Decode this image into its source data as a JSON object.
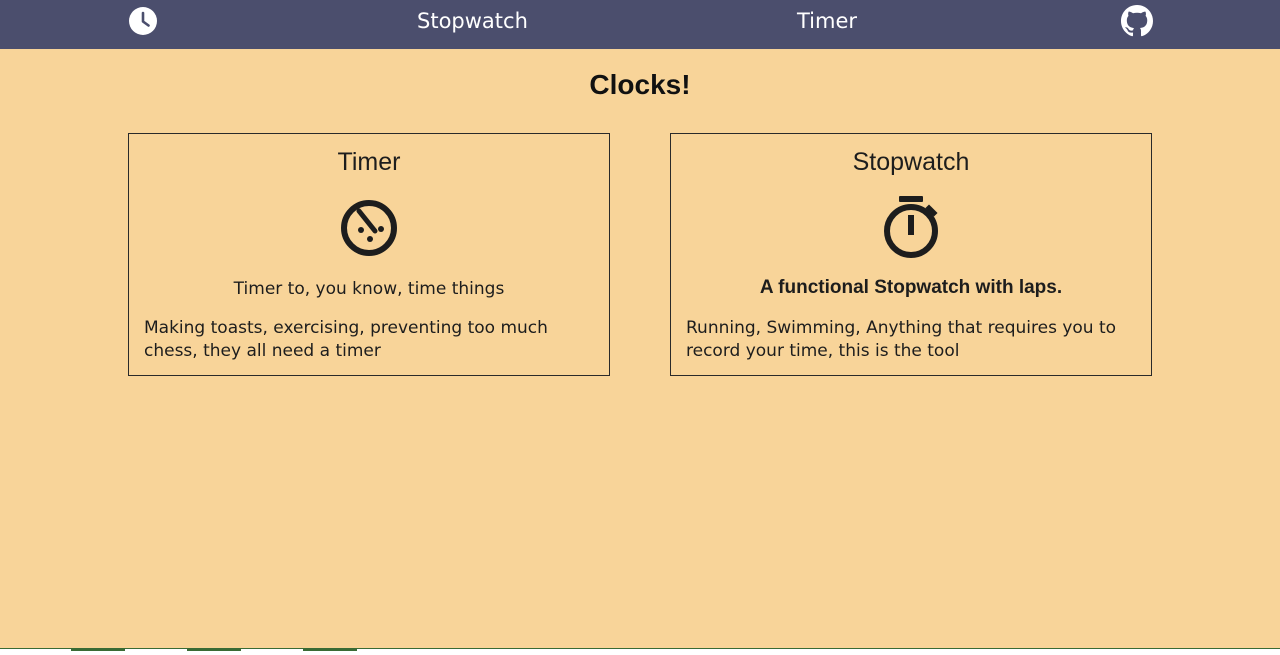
{
  "nav": {
    "home_icon": "clock-icon",
    "links": [
      {
        "label": "Stopwatch"
      },
      {
        "label": "Timer"
      }
    ],
    "github_icon": "github-icon"
  },
  "page": {
    "title": "Clocks!"
  },
  "cards": [
    {
      "title": "Timer",
      "icon": "timer-icon",
      "subtitle": "Timer to, you know, time things",
      "description": "Making toasts, exercising, preventing too much chess, they all need a timer"
    },
    {
      "title": "Stopwatch",
      "icon": "stopwatch-icon",
      "subtitle": "A functional Stopwatch with laps.",
      "description": "Running, Swimming, Anything that requires you to record your time, this is the tool"
    }
  ],
  "colors": {
    "navbar": "#4B4E6D",
    "background": "#F8D499",
    "nav_text": "#FFFFFF",
    "text": "#1D1D1D"
  }
}
